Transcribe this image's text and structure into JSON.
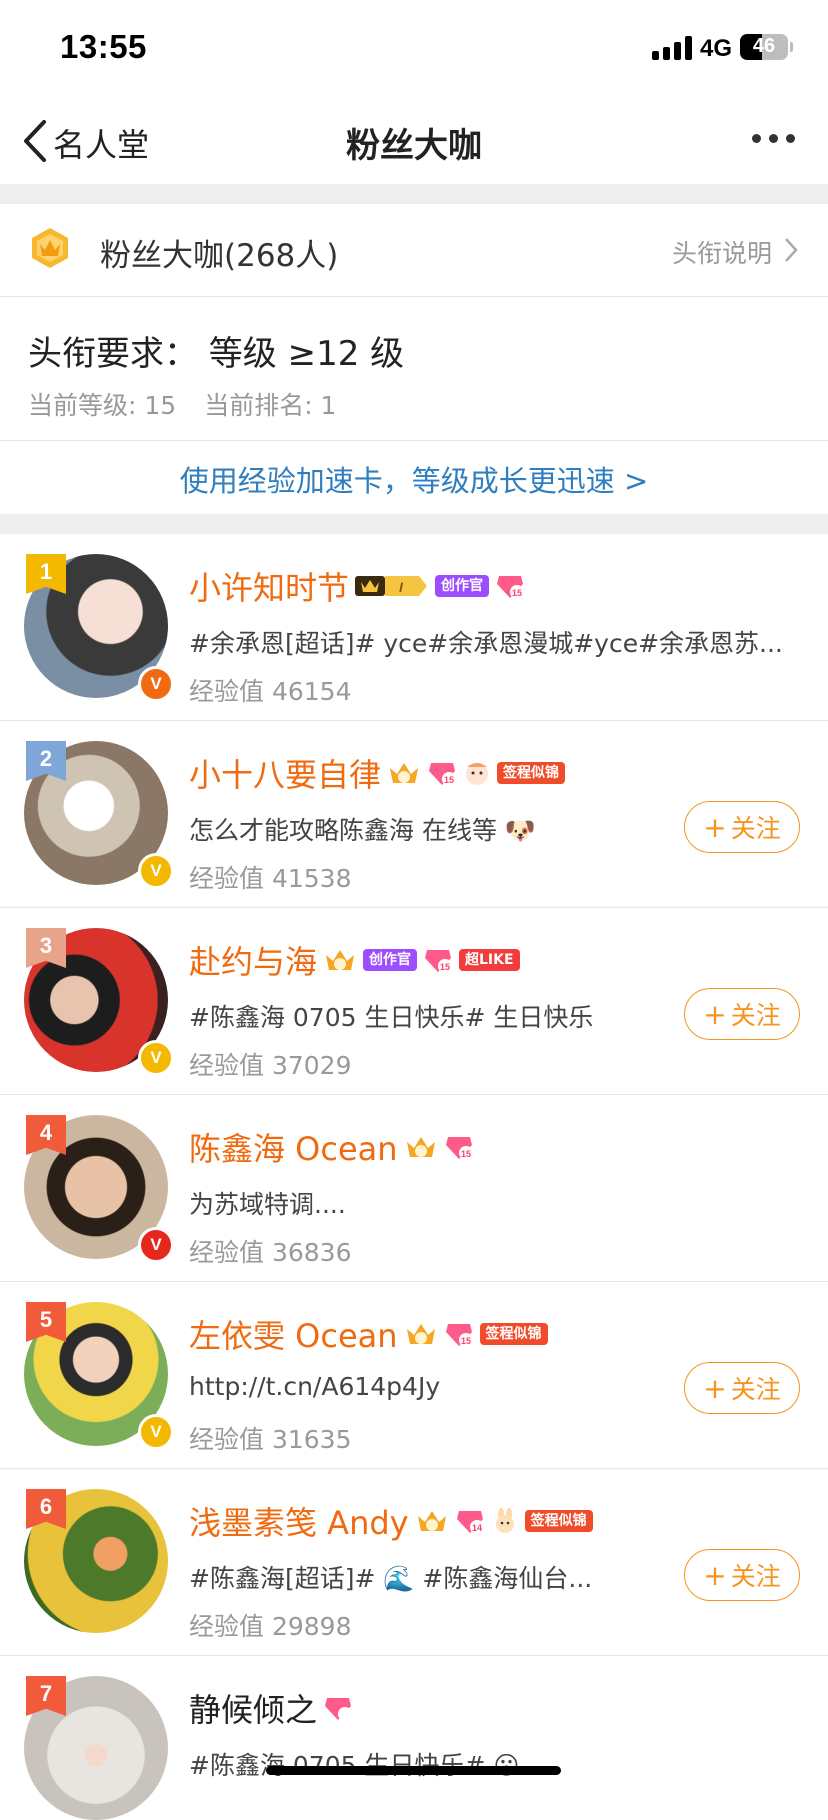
{
  "status_bar": {
    "time": "13:55",
    "network": "4G",
    "battery": "46"
  },
  "nav": {
    "back_label": "名人堂",
    "title": "粉丝大咖"
  },
  "header": {
    "badge_label": "粉丝大咖(268人)",
    "explain_link": "头衔说明",
    "requirement": "头衔要求：  等级 ≥12 级",
    "current_level": "当前等级: 15",
    "current_rank": "当前排名: 1",
    "promo": "使用经验加速卡，等级成长更迅速 >"
  },
  "chips": {
    "creator": "创作官",
    "sign": "签程似锦",
    "superlike": "超LIKE"
  },
  "follow_label": "关注",
  "users": [
    {
      "rank": "1",
      "name": "小许知时节",
      "desc": "#余承恩[超话]# yce#余承恩漫城#yce#余承恩苏...",
      "exp": "经验值 46154"
    },
    {
      "rank": "2",
      "name": "小十八要自律",
      "desc": "怎么才能攻略陈鑫海 在线等",
      "exp": "经验值 41538"
    },
    {
      "rank": "3",
      "name": "赴约与海",
      "desc": "#陈鑫海 0705 生日快乐# 生日快乐",
      "exp": "经验值 37029"
    },
    {
      "rank": "4",
      "name": "陈鑫海 Ocean",
      "desc": "为苏域特调....",
      "exp": "经验值 36836"
    },
    {
      "rank": "5",
      "name": "左依雯 Ocean",
      "desc": "http://t.cn/A614p4Jy",
      "exp": "经验值 31635"
    },
    {
      "rank": "6",
      "name": "浅墨素笺 Andy",
      "desc": "#陈鑫海[超话]# 🌊 #陈鑫海仙台...",
      "exp": "经验值 29898"
    },
    {
      "rank": "7",
      "name": "静候倾之",
      "desc": "#陈鑫海 0705 生日快乐# 😮",
      "exp": ""
    }
  ]
}
